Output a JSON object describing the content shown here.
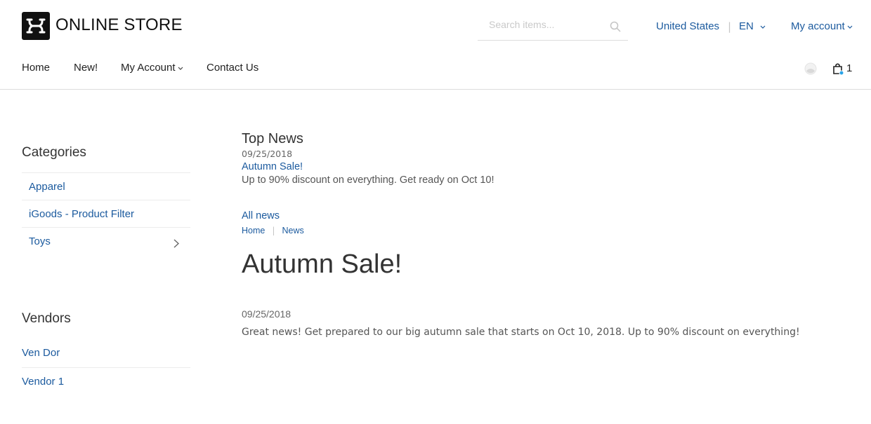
{
  "header": {
    "logo_text": "ONLINE STORE",
    "search_placeholder": "Search items...",
    "country": "United States",
    "separator": "|",
    "language": "EN",
    "account": "My account"
  },
  "nav": {
    "items": [
      "Home",
      "New!",
      "My Account",
      "Contact Us"
    ],
    "cart_count": "1"
  },
  "sidebar": {
    "categories_title": "Categories",
    "categories": [
      "Apparel",
      "iGoods - Product Filter",
      "Toys"
    ],
    "vendors_title": "Vendors",
    "vendors": [
      "Ven Dor",
      "Vendor 1"
    ]
  },
  "top_news": {
    "title": "Top News",
    "date": "09/25/2018",
    "headline": "Autumn Sale!",
    "summary": "Up to 90% discount on everything. Get ready on Oct 10!",
    "all_news": "All news"
  },
  "breadcrumb": {
    "home": "Home",
    "separator": "|",
    "news": "News"
  },
  "article": {
    "title": "Autumn Sale!",
    "date": "09/25/2018",
    "body": "Great news! Get prepared to our big autumn sale that starts on Oct 10, 2018. Up to 90% discount on everything!"
  },
  "colors": {
    "link": "#1b5a9e",
    "text": "#333333",
    "cart_dot": "#2aa3e8"
  }
}
